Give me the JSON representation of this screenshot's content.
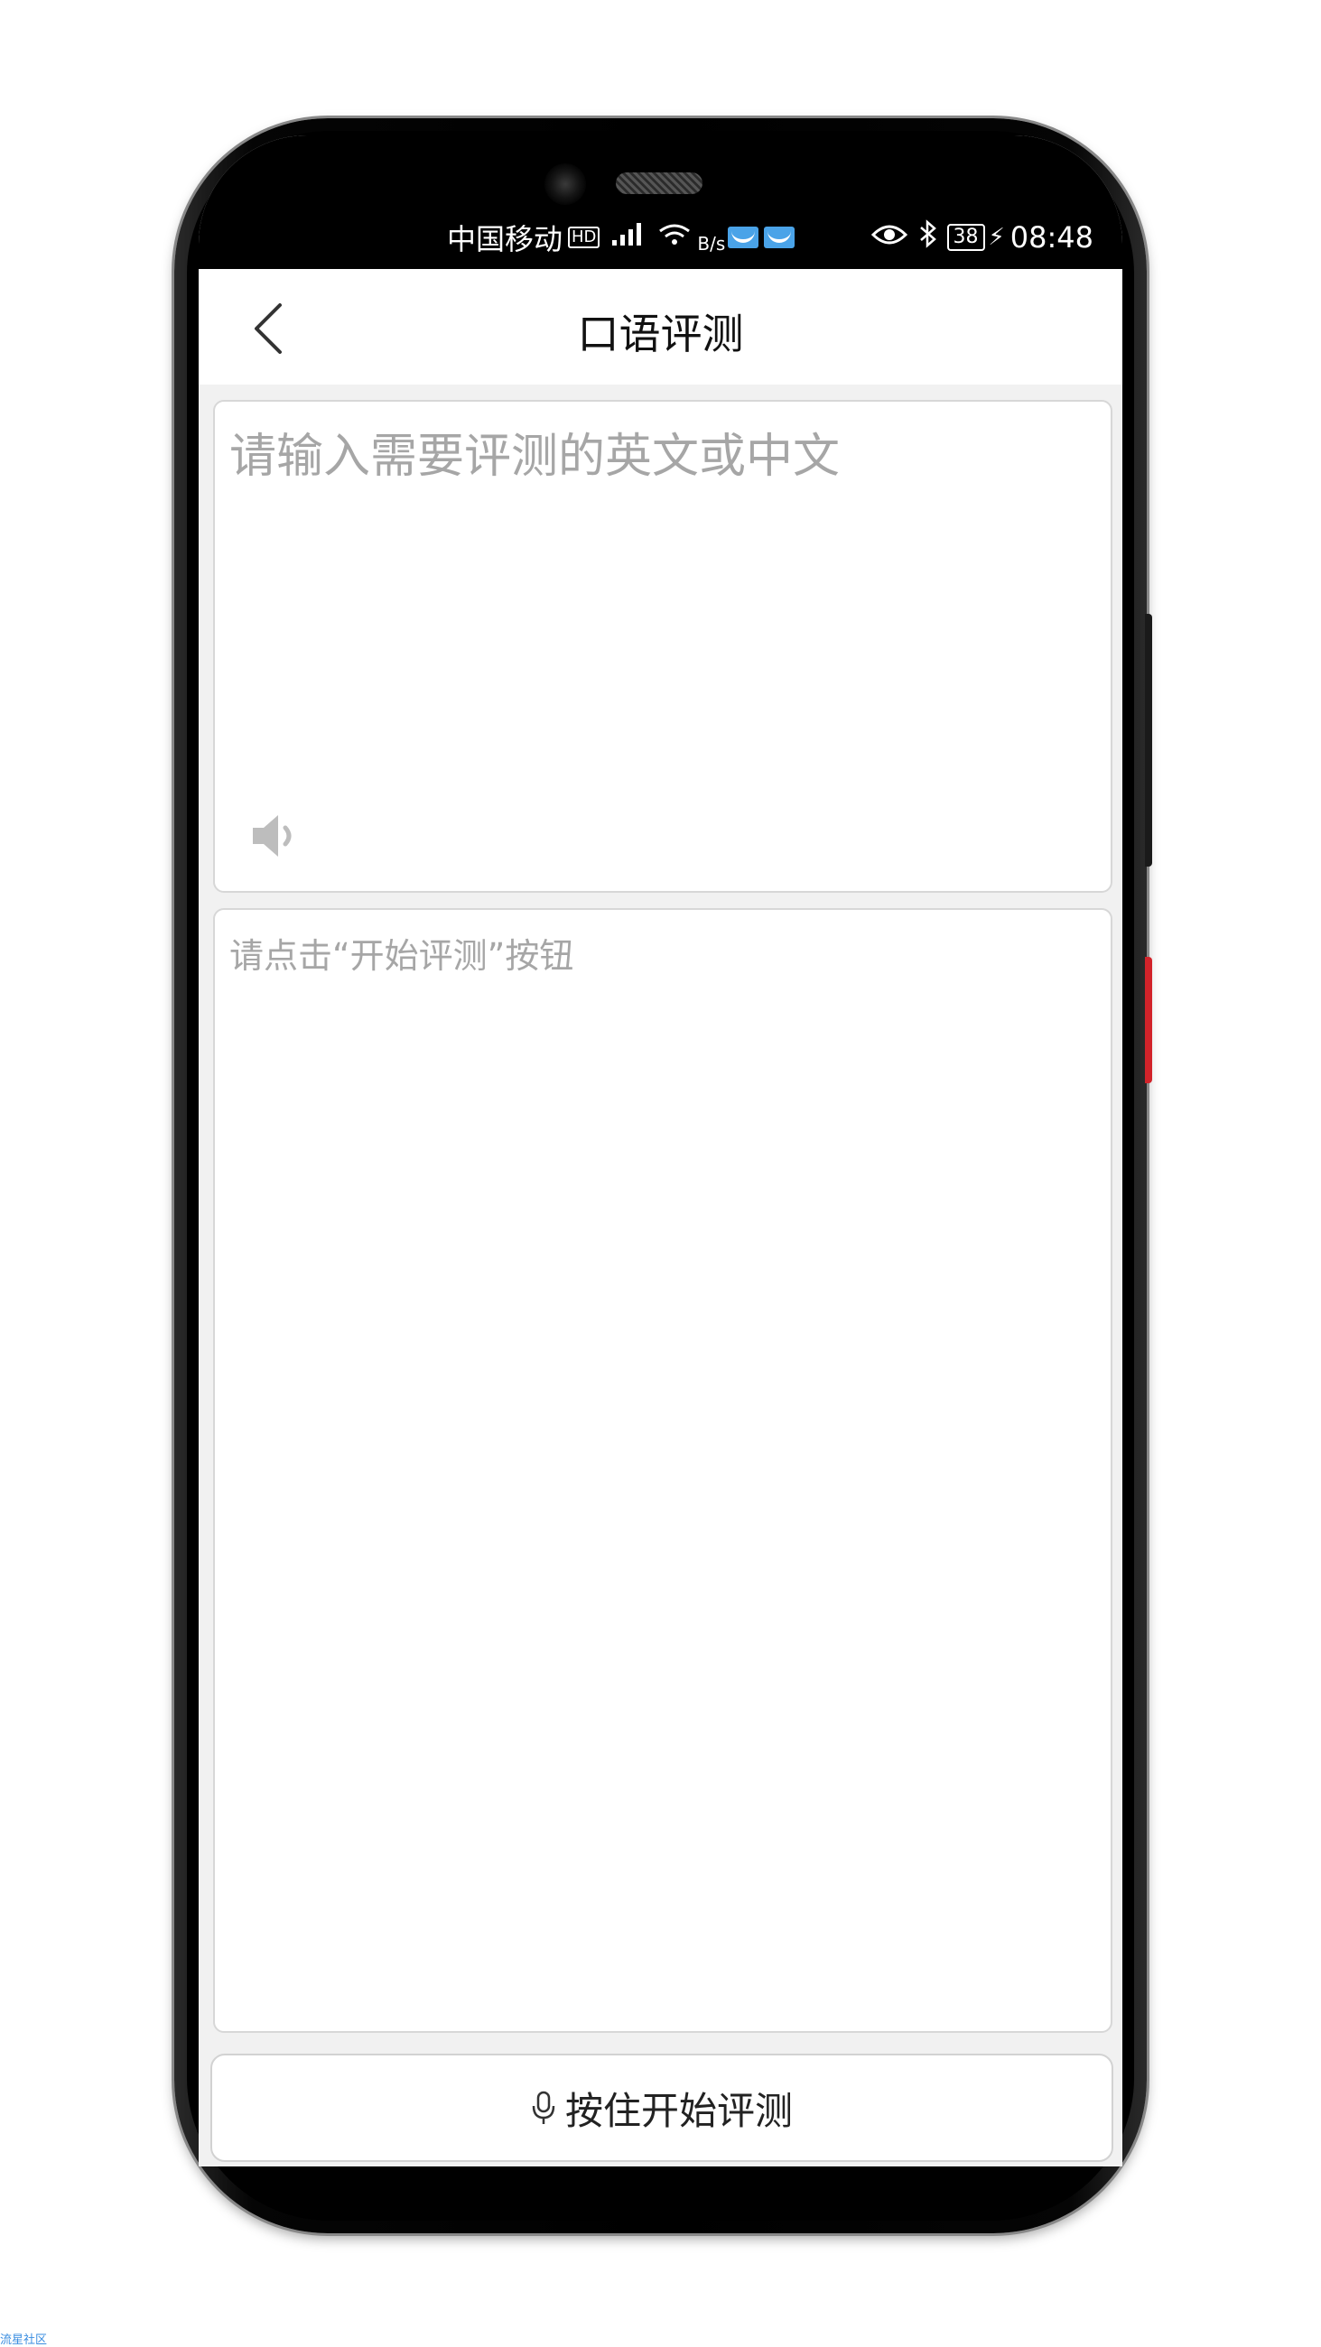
{
  "status_bar": {
    "carrier": "中国移动",
    "hd_badge": "HD",
    "signal_icon": "signal-icon",
    "wifi_icon": "wifi-icon",
    "net_speed_unit": "B/s",
    "battery_level": "38",
    "time": "08:48"
  },
  "header": {
    "title": "口语评测",
    "back_icon": "back-chevron-icon"
  },
  "input": {
    "placeholder": "请输入需要评测的英文或中文",
    "value": ""
  },
  "speaker": {
    "icon": "speaker-icon"
  },
  "result": {
    "placeholder": "请点击“开始评测”按钮"
  },
  "footer": {
    "record_label": "按住开始评测",
    "record_icon": "microphone-icon"
  },
  "watermark": {
    "text": "流星社区"
  },
  "colors": {
    "page_background": "#f1f1f1",
    "card_border": "#d7d7d7",
    "placeholder_text": "#a6a6a6",
    "title_text": "#111111",
    "status_bar_background": "#000000",
    "watermark_text": "#3a8de0",
    "power_button": "#d2232a"
  }
}
